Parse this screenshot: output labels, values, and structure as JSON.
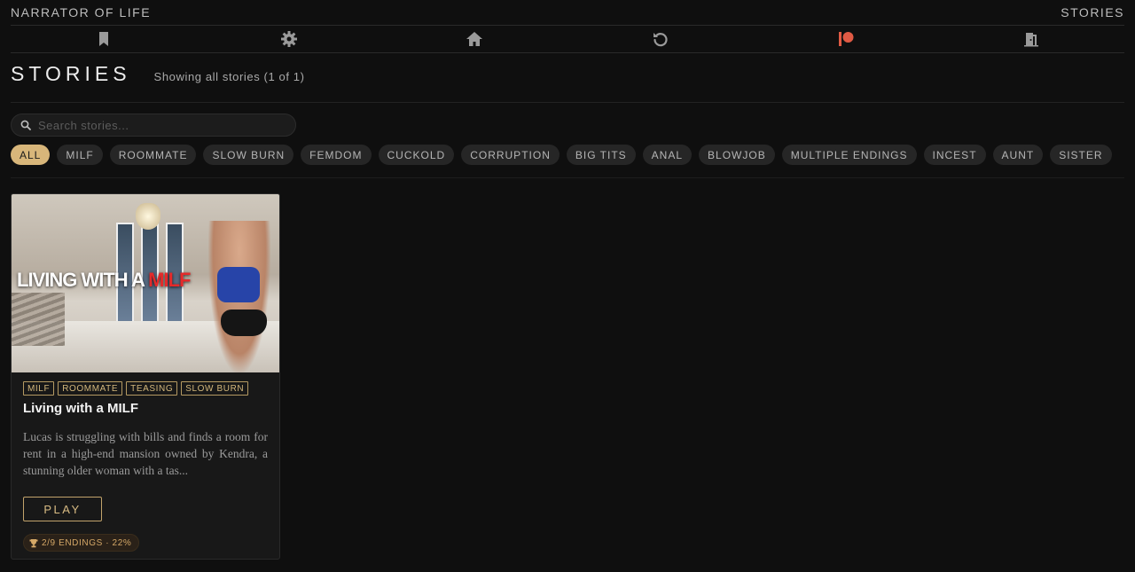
{
  "header": {
    "brand": "NARRATOR OF LIFE",
    "section_link": "STORIES"
  },
  "nav": [
    {
      "name": "bookmark-icon"
    },
    {
      "name": "gear-icon"
    },
    {
      "name": "home-icon"
    },
    {
      "name": "undo-icon"
    },
    {
      "name": "patreon-icon",
      "color": "#e05a44"
    },
    {
      "name": "exit-door-icon"
    }
  ],
  "page": {
    "title": "STORIES",
    "subtitle": "Showing all stories (1 of 1)"
  },
  "search": {
    "placeholder": "Search stories...",
    "value": ""
  },
  "filters": [
    "ALL",
    "MILF",
    "ROOMMATE",
    "SLOW BURN",
    "FEMDOM",
    "CUCKOLD",
    "CORRUPTION",
    "BIG TITS",
    "ANAL",
    "BLOWJOB",
    "MULTIPLE ENDINGS",
    "INCEST",
    "AUNT",
    "SISTER"
  ],
  "active_filter": "ALL",
  "story": {
    "cover_title_main": "LIVING WITH A ",
    "cover_title_accent": "MILF",
    "tags": [
      "MILF",
      "ROOMMATE",
      "TEASING",
      "SLOW BURN"
    ],
    "title": "Living with a MILF",
    "description": "Lucas is struggling with bills and finds a room for rent in a high-end mansion owned by Kendra, a stunning older woman with a tas...",
    "play_label": "PLAY",
    "endings": "2/9 ENDINGS · 22%"
  },
  "colors": {
    "accent": "#d8b67a",
    "background": "#0f0f0f",
    "patreon": "#e05a44"
  }
}
